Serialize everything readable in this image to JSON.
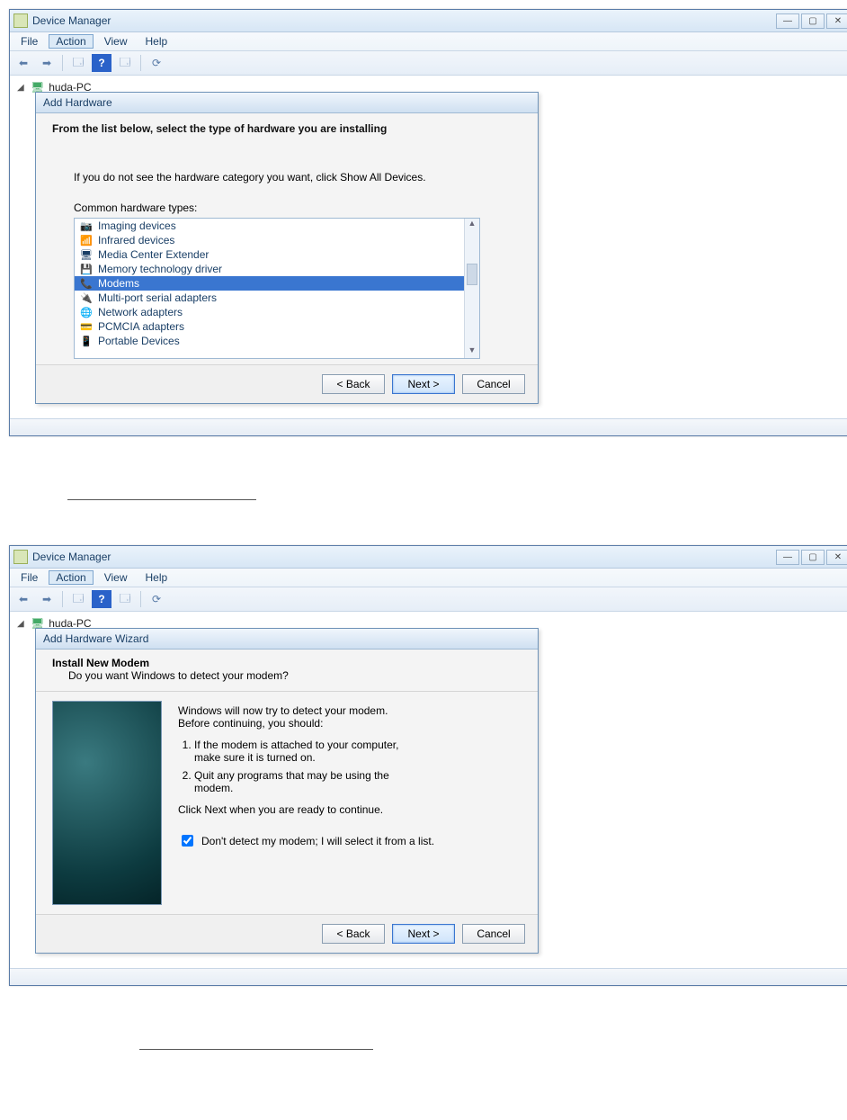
{
  "window": {
    "title": "Device Manager",
    "menus": {
      "file": "File",
      "action": "Action",
      "view": "View",
      "help": "Help"
    },
    "tree_root": "huda-PC"
  },
  "dialog1": {
    "title": "Add Hardware",
    "heading": "From the list below, select the type of hardware you are installing",
    "hint": "If you do not see the hardware category you want, click Show All Devices.",
    "list_label": "Common hardware types:",
    "items": [
      "Imaging devices",
      "Infrared devices",
      "Media Center Extender",
      "Memory technology driver",
      "Modems",
      "Multi-port serial adapters",
      "Network adapters",
      "PCMCIA adapters",
      "Portable Devices"
    ],
    "selected_index": 4,
    "buttons": {
      "back": "< Back",
      "next": "Next >",
      "cancel": "Cancel"
    }
  },
  "dialog2": {
    "title": "Add Hardware Wizard",
    "h1": "Install New Modem",
    "h2": "Do you want Windows to detect your modem?",
    "intro": "Windows will now try to detect your modem.  Before continuing, you should:",
    "steps": [
      "If the modem is attached to your computer, make sure it is turned on.",
      "Quit any programs that may be using the modem."
    ],
    "ready": "Click Next when you are ready to continue.",
    "checkbox_label": "Don't detect my modem; I will select it from a list.",
    "checkbox_checked": true,
    "buttons": {
      "back": "< Back",
      "next": "Next >",
      "cancel": "Cancel"
    }
  }
}
